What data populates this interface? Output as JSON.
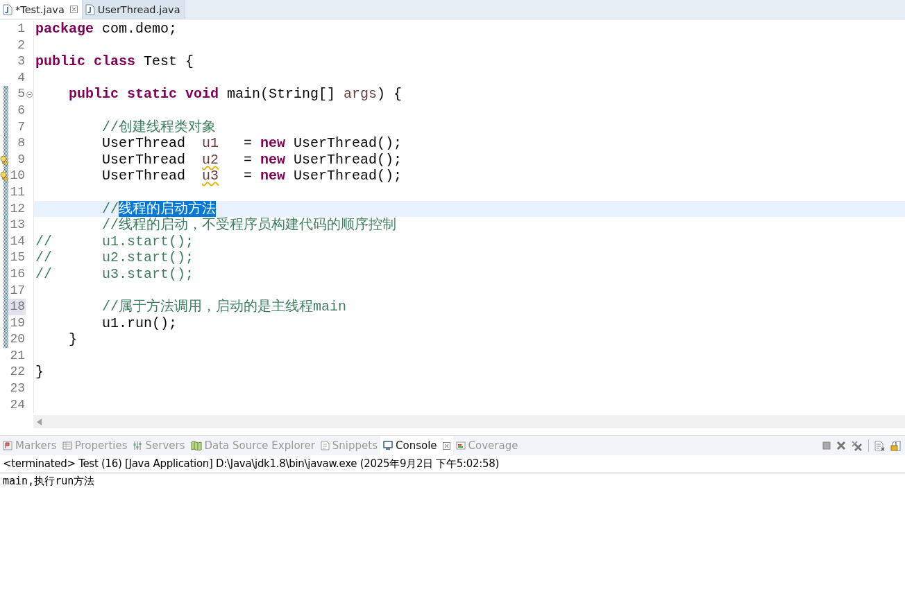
{
  "editor_tabs": [
    {
      "label": "*Test.java",
      "selected": true,
      "closable": true
    },
    {
      "label": "UserThread.java",
      "selected": false,
      "closable": false
    }
  ],
  "code_lines": [
    {
      "number": "1",
      "changed": false,
      "warning": false,
      "current": false,
      "marked": false,
      "tokens": [
        {
          "kind": "keyword",
          "text": "package "
        },
        {
          "kind": "plain",
          "text": "com.demo;"
        }
      ]
    },
    {
      "number": "2",
      "changed": false,
      "warning": false,
      "current": false,
      "marked": false
    },
    {
      "number": "3",
      "changed": false,
      "warning": false,
      "current": false,
      "marked": false,
      "tokens": [
        {
          "kind": "keyword",
          "text": "public class "
        },
        {
          "kind": "plain",
          "text": "Test {"
        }
      ]
    },
    {
      "number": "4",
      "changed": false,
      "warning": false,
      "current": false,
      "marked": false
    },
    {
      "number": "5",
      "changed": true,
      "warning": false,
      "current": false,
      "marked": false,
      "expanded": true,
      "tokens": [
        {
          "kind": "keyword",
          "text": "    public static void "
        },
        {
          "kind": "plain",
          "text": "main(String[] "
        },
        {
          "kind": "variable",
          "text": "args"
        },
        {
          "kind": "plain",
          "text": ") {"
        }
      ]
    },
    {
      "number": "6",
      "changed": true,
      "warning": false,
      "current": false,
      "marked": false
    },
    {
      "number": "7",
      "changed": true,
      "warning": false,
      "current": false,
      "marked": false,
      "tokens": [
        {
          "kind": "comment",
          "text": "        //创建线程类对象"
        }
      ]
    },
    {
      "number": "8",
      "changed": true,
      "warning": false,
      "current": false,
      "marked": false,
      "tokens": [
        {
          "kind": "plain",
          "text": "        UserThread  "
        },
        {
          "kind": "variable",
          "text": "u1"
        },
        {
          "kind": "plain",
          "text": "   = "
        },
        {
          "kind": "keyword",
          "text": "new "
        },
        {
          "kind": "plain",
          "text": "UserThread();"
        }
      ]
    },
    {
      "number": "9",
      "changed": true,
      "warning": true,
      "current": false,
      "marked": false,
      "tokens": [
        {
          "kind": "plain",
          "text": "        UserThread  "
        },
        {
          "kind": "unused",
          "text": "u2"
        },
        {
          "kind": "plain",
          "text": "   = "
        },
        {
          "kind": "keyword",
          "text": "new "
        },
        {
          "kind": "plain",
          "text": "UserThread();"
        }
      ]
    },
    {
      "number": "10",
      "changed": true,
      "warning": true,
      "current": false,
      "marked": false,
      "tokens": [
        {
          "kind": "plain",
          "text": "        UserThread  "
        },
        {
          "kind": "unused",
          "text": "u3"
        },
        {
          "kind": "plain",
          "text": "   = "
        },
        {
          "kind": "keyword",
          "text": "new "
        },
        {
          "kind": "plain",
          "text": "UserThread();"
        }
      ]
    },
    {
      "number": "11",
      "changed": true,
      "warning": false,
      "current": false,
      "marked": false
    },
    {
      "number": "12",
      "changed": true,
      "warning": false,
      "current": true,
      "marked": false,
      "tokens": [
        {
          "kind": "comment",
          "text": "        //"
        },
        {
          "kind": "selection",
          "text": "线程的启动方法"
        }
      ]
    },
    {
      "number": "13",
      "changed": true,
      "warning": false,
      "current": false,
      "marked": false,
      "tokens": [
        {
          "kind": "comment",
          "text": "        //线程的启动，不受程序员构建代码的顺序控制"
        }
      ]
    },
    {
      "number": "14",
      "changed": true,
      "warning": false,
      "current": false,
      "marked": false,
      "tokens": [
        {
          "kind": "comment",
          "text": "//      u1.start();"
        }
      ]
    },
    {
      "number": "15",
      "changed": true,
      "warning": false,
      "current": false,
      "marked": false,
      "tokens": [
        {
          "kind": "comment",
          "text": "//      u2.start();"
        }
      ]
    },
    {
      "number": "16",
      "changed": true,
      "warning": false,
      "current": false,
      "marked": false,
      "tokens": [
        {
          "kind": "comment",
          "text": "//      u3.start();"
        }
      ]
    },
    {
      "number": "17",
      "changed": true,
      "warning": false,
      "current": false,
      "marked": false
    },
    {
      "number": "18",
      "changed": true,
      "warning": false,
      "current": false,
      "marked": true,
      "tokens": [
        {
          "kind": "comment",
          "text": "        //属于方法调用，启动的是主线程main"
        }
      ]
    },
    {
      "number": "19",
      "changed": true,
      "warning": false,
      "current": false,
      "marked": false,
      "tokens": [
        {
          "kind": "plain",
          "text": "        u1.run();"
        }
      ]
    },
    {
      "number": "20",
      "changed": true,
      "warning": false,
      "current": false,
      "marked": false,
      "tokens": [
        {
          "kind": "plain",
          "text": "    }"
        }
      ]
    },
    {
      "number": "21",
      "changed": false,
      "warning": false,
      "current": false,
      "marked": false
    },
    {
      "number": "22",
      "changed": false,
      "warning": false,
      "current": false,
      "marked": false,
      "tokens": [
        {
          "kind": "plain",
          "text": "}"
        }
      ]
    },
    {
      "number": "23",
      "changed": false,
      "warning": false,
      "current": false,
      "marked": false
    },
    {
      "number": "24",
      "changed": false,
      "warning": false,
      "current": false,
      "marked": false
    }
  ],
  "panel_tabs": [
    {
      "label": "Markers",
      "kind": "markers",
      "selected": false
    },
    {
      "label": "Properties",
      "kind": "properties",
      "selected": false
    },
    {
      "label": "Servers",
      "kind": "servers",
      "selected": false
    },
    {
      "label": "Data Source Explorer",
      "kind": "datasource",
      "selected": false
    },
    {
      "label": "Snippets",
      "kind": "snippets",
      "selected": false
    },
    {
      "label": "Console",
      "kind": "console",
      "selected": true
    },
    {
      "label": "Coverage",
      "kind": "coverage",
      "selected": false
    }
  ],
  "console": {
    "header": "<terminated> Test (16) [Java Application] D:\\Java\\jdk1.8\\bin\\javaw.exe (2025年9月2日 下午5:02:58)",
    "output": "main,执行run方法"
  }
}
